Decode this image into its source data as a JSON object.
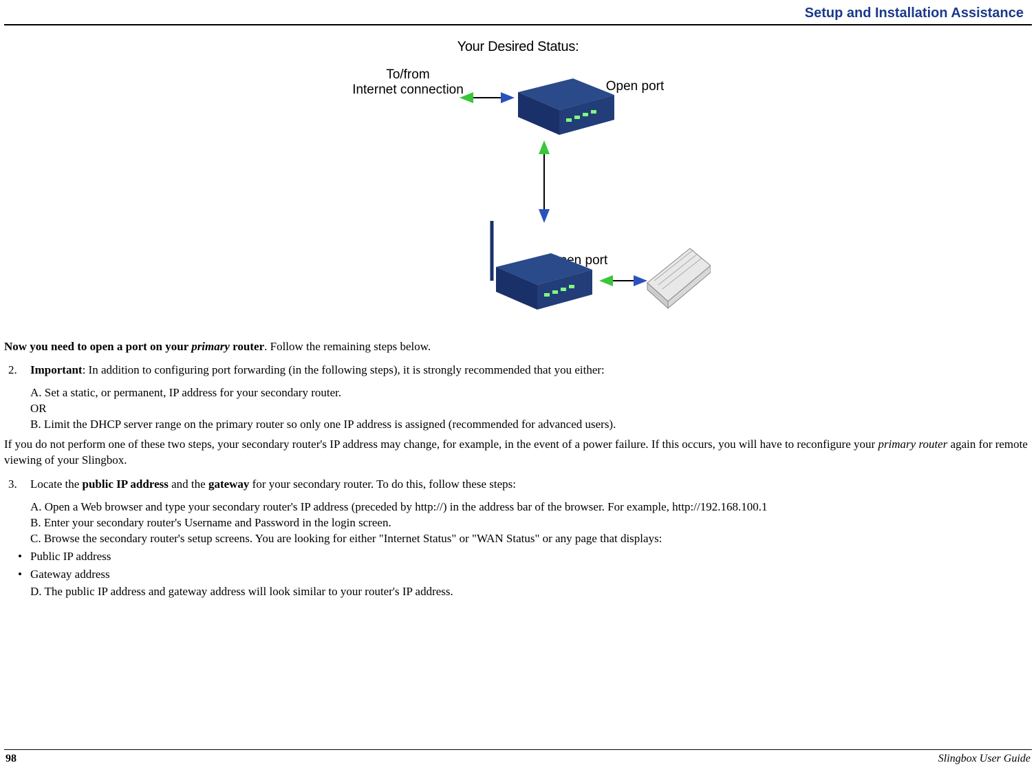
{
  "header": {
    "section_title": "Setup and Installation Assistance"
  },
  "diagram": {
    "title": "Your Desired Status:",
    "labels": {
      "tofrom": "To/from",
      "internet": "Internet connection",
      "open_port_top": "Open port",
      "open_port_bottom": "Open port"
    }
  },
  "body": {
    "lead_bold_a": "Now you need to open a port on your ",
    "lead_ital": "primary",
    "lead_bold_b": " router",
    "lead_plain": ". Follow the remaining steps below.",
    "step2": {
      "num": "2.",
      "label_bold": "Important",
      "label_rest": ": In addition to configuring port forwarding (in the following steps), it is strongly recommended that you either:",
      "a": "A. Set a static, or permanent, IP address for your secondary router.",
      "or": "OR",
      "b": "B. Limit the DHCP server range on the primary router so only one IP address is assigned (recommended for advanced users)."
    },
    "warning": {
      "pre": "If you do not perform one of these two steps, your secondary router's IP address may change, for example, in the event of a power failure. If this occurs, you will have to reconfigure your ",
      "ital": "primary router",
      "post": " again for remote viewing of your Slingbox."
    },
    "step3": {
      "num": "3.",
      "pre": "Locate the ",
      "b1": "public IP address",
      "mid": " and the ",
      "b2": "gateway",
      "post": " for your secondary router. To do this, follow these steps:",
      "a": "A. Open a Web browser and type your secondary router's IP address (preceded by http://) in the address bar of the browser. For example, http://192.168.100.1",
      "b": "B. Enter your secondary router's Username and Password in the login screen.",
      "c": "C. Browse the secondary router's setup screens. You are looking for either \"Internet Status\" or \"WAN Status\" or any page that displays:",
      "bullets": [
        "Public IP address",
        "Gateway address"
      ],
      "d": "D. The public IP address and gateway address will look similar to your router's IP address."
    }
  },
  "footer": {
    "page": "98",
    "guide": "Slingbox User Guide"
  }
}
